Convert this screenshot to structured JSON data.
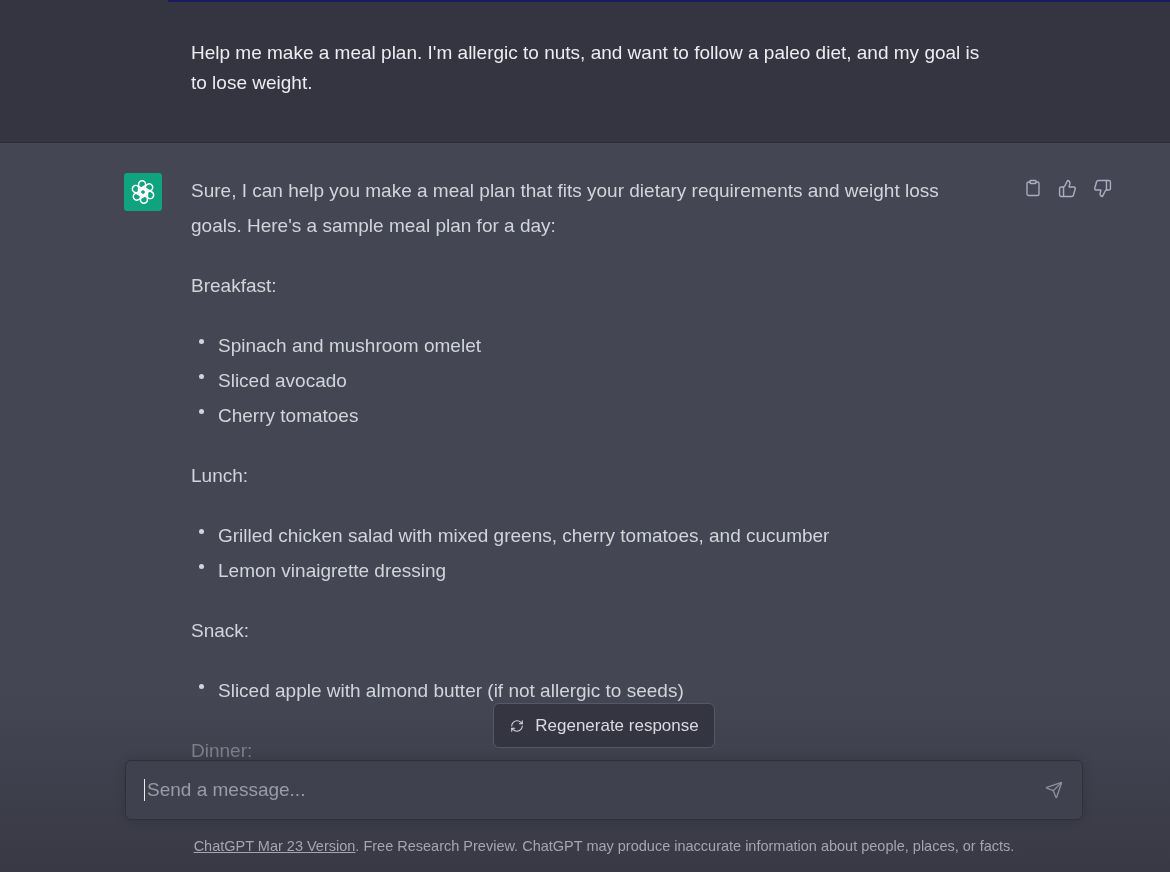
{
  "user_message": {
    "text": "Help me make a meal plan. I'm allergic to nuts, and want to follow a paleo diet, and my goal is to lose weight."
  },
  "assistant_message": {
    "blocks": [
      {
        "kind": "paragraph",
        "faded": false,
        "text": "Sure, I can help you make a meal plan that fits your dietary requirements and weight loss goals. Here's a sample meal plan for a day:"
      },
      {
        "kind": "paragraph",
        "faded": false,
        "text": "Breakfast:"
      },
      {
        "kind": "list",
        "faded": false,
        "items": [
          "Spinach and mushroom omelet",
          "Sliced avocado",
          "Cherry tomatoes"
        ]
      },
      {
        "kind": "paragraph",
        "faded": false,
        "text": "Lunch:"
      },
      {
        "kind": "list",
        "faded": false,
        "items": [
          "Grilled chicken salad with mixed greens, cherry tomatoes, and cucumber",
          "Lemon vinaigrette dressing"
        ]
      },
      {
        "kind": "paragraph",
        "faded": false,
        "text": "Snack:"
      },
      {
        "kind": "list",
        "faded": false,
        "items": [
          "Sliced apple with almond butter (if not allergic to seeds)"
        ]
      },
      {
        "kind": "paragraph",
        "faded": true,
        "text": "Dinner:"
      }
    ]
  },
  "regenerate_button": {
    "label": "Regenerate response"
  },
  "composer": {
    "placeholder": "Send a message..."
  },
  "footer": {
    "link": "ChatGPT Mar 23 Version",
    "text": ". Free Research Preview. ChatGPT may produce inaccurate information about people, places, or facts."
  }
}
